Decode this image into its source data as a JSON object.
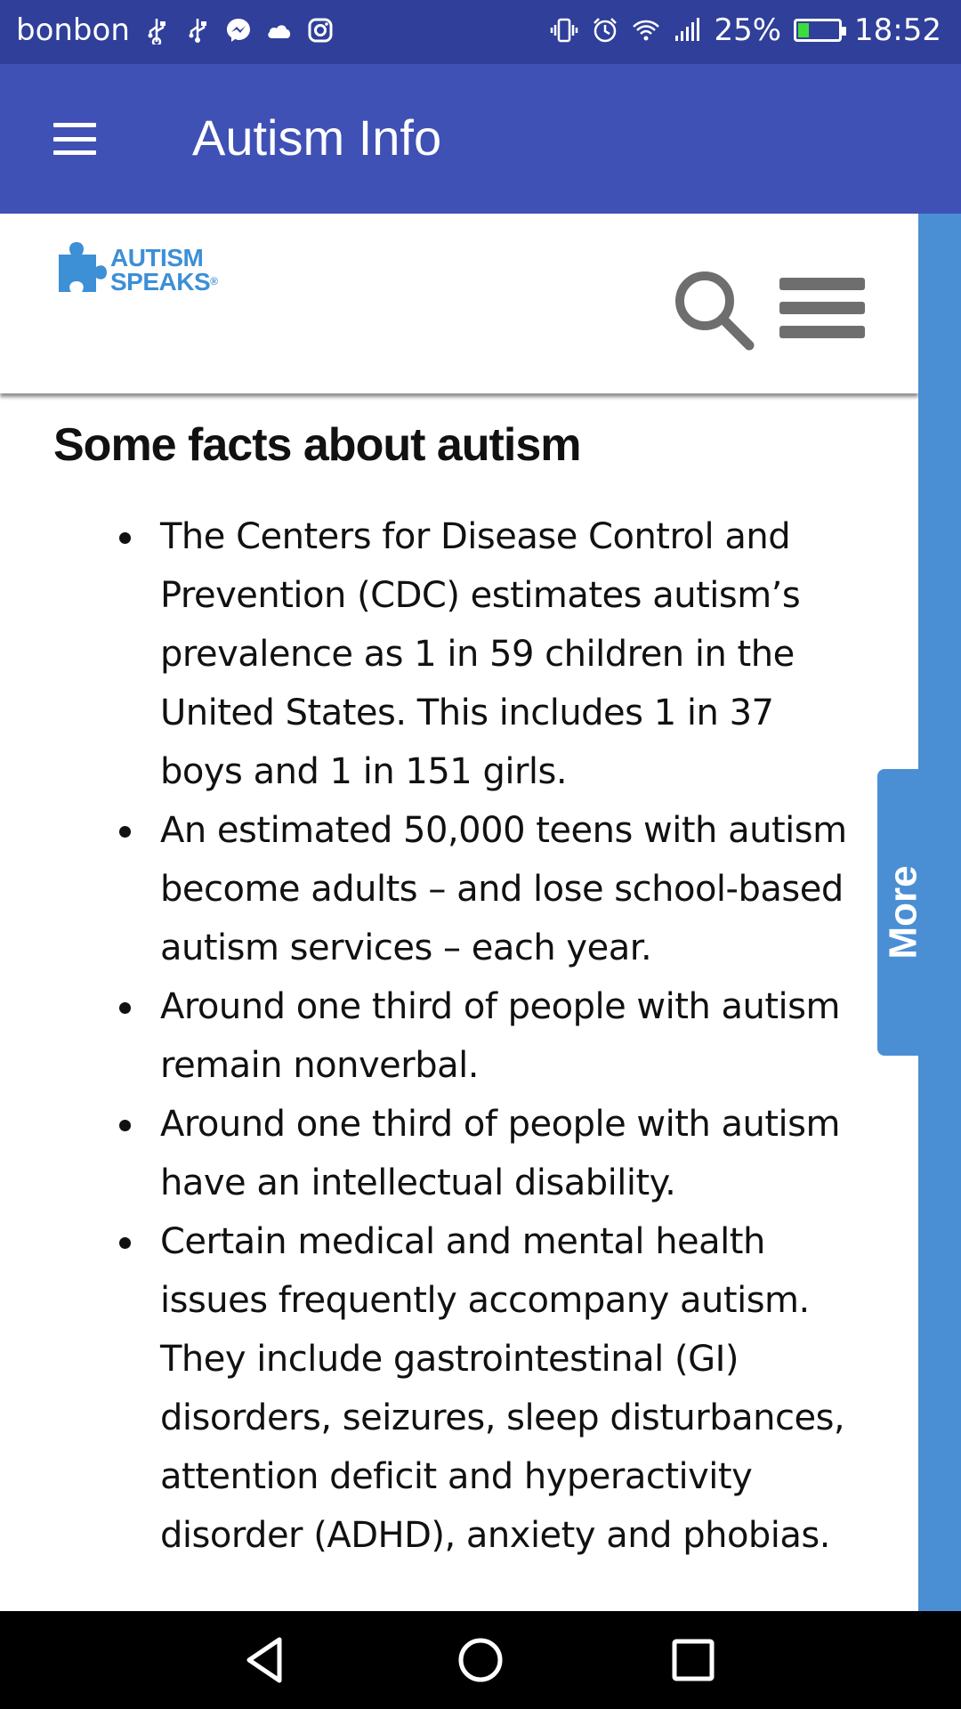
{
  "status_bar": {
    "carrier": "bonbon",
    "battery_percent": "25%",
    "time": "18:52",
    "battery_level": 0.25,
    "left_icons": [
      "usb-icon",
      "usb-icon",
      "messenger-icon",
      "cloud-icon",
      "instagram-icon"
    ],
    "right_icons": [
      "vibrate-icon",
      "alarm-icon",
      "wifi-icon",
      "signal-icon",
      "battery-icon"
    ]
  },
  "app_bar": {
    "title": "Autism Info",
    "menu_icon": "hamburger-icon"
  },
  "site_header": {
    "logo_line1": "AUTISM",
    "logo_line2": "SPEAKS",
    "logo_registered": "®",
    "brand_color": "#3d8fd6",
    "search_icon": "search-icon",
    "menu_icon": "menu-icon"
  },
  "article": {
    "heading": "Some facts about autism",
    "facts": [
      "The Centers for Disease Control and Prevention (CDC) estimates autism’s prevalence as 1 in 59 children in the United States. This includes 1 in 37 boys and 1 in 151 girls.",
      "An estimated 50,000 teens with autism become adults – and lose school-based autism services – each year.",
      "Around one third of people with autism remain nonverbal.",
      "Around one third of people with autism have an intellectual disability.",
      "Certain medical and mental health issues frequently accompany autism. They include gastrointestinal (GI) disorders, seizures, sleep disturbances, attention deficit and hyperactivity disorder (ADHD), anxiety and phobias."
    ]
  },
  "side_tab": {
    "label": "More",
    "color": "#4a8fd4"
  },
  "nav_bar": {
    "back_icon": "back-icon",
    "home_icon": "home-icon",
    "recents_icon": "recents-icon"
  },
  "colors": {
    "status_bar": "#2f3f9a",
    "app_bar": "#3f51b5",
    "battery_fill": "#3ddc3d"
  }
}
